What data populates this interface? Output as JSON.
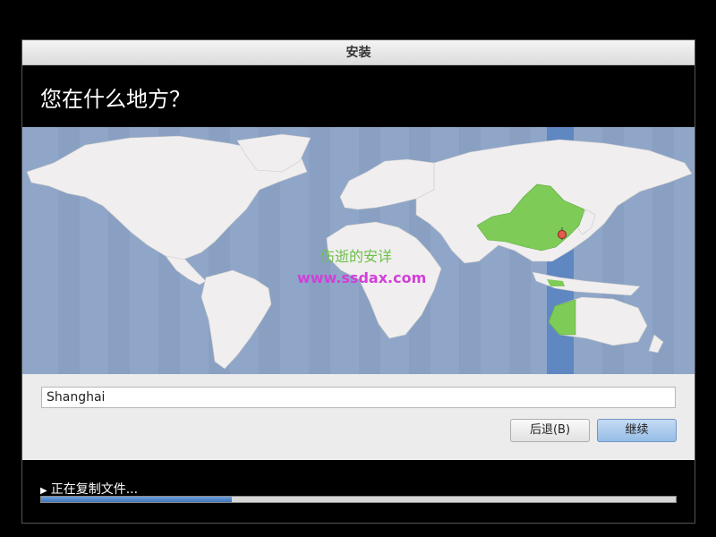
{
  "window": {
    "title": "安装"
  },
  "page": {
    "heading": "您在什么地方？"
  },
  "map": {
    "selected_city": "Shanghai",
    "highlight_color": "#7ecb58",
    "ocean_color": "#8fa6c8",
    "timezone_band_color": "#5f87c2",
    "watermark": {
      "cn": "伤逝的安详",
      "url": "www.ssdax.com"
    }
  },
  "timezone": {
    "value": "Shanghai"
  },
  "buttons": {
    "back": "后退(B)",
    "continue": "继续"
  },
  "status": {
    "text": "正在复制文件...",
    "progress_percent": 30
  },
  "colors": {
    "accent": "#4f82c4"
  }
}
